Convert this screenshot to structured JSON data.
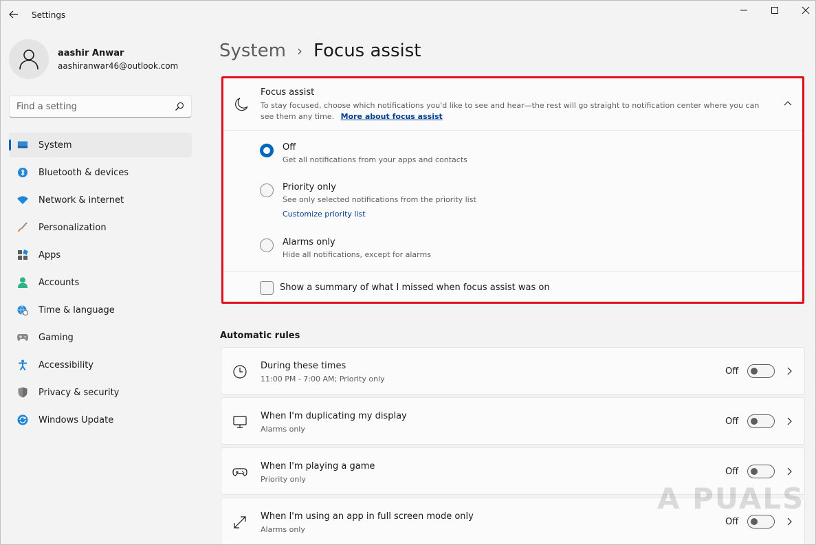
{
  "window": {
    "title": "Settings"
  },
  "profile": {
    "name": "aashir Anwar",
    "email": "aashiranwar46@outlook.com"
  },
  "search": {
    "placeholder": "Find a setting"
  },
  "nav": {
    "items": [
      {
        "label": "System",
        "icon": "system-icon",
        "active": true
      },
      {
        "label": "Bluetooth & devices",
        "icon": "bluetooth-icon"
      },
      {
        "label": "Network & internet",
        "icon": "wifi-icon"
      },
      {
        "label": "Personalization",
        "icon": "brush-icon"
      },
      {
        "label": "Apps",
        "icon": "apps-icon"
      },
      {
        "label": "Accounts",
        "icon": "accounts-icon"
      },
      {
        "label": "Time & language",
        "icon": "globe-clock-icon"
      },
      {
        "label": "Gaming",
        "icon": "gamepad-icon"
      },
      {
        "label": "Accessibility",
        "icon": "accessibility-icon"
      },
      {
        "label": "Privacy & security",
        "icon": "shield-icon"
      },
      {
        "label": "Windows Update",
        "icon": "update-icon"
      }
    ]
  },
  "breadcrumb": {
    "parent": "System",
    "separator": "›",
    "current": "Focus assist"
  },
  "focus_assist": {
    "title": "Focus assist",
    "description": "To stay focused, choose which notifications you'd like to see and hear—the rest will go straight to notification center where you can see them any time.",
    "link": "More about focus assist",
    "options": [
      {
        "label": "Off",
        "desc": "Get all notifications from your apps and contacts",
        "checked": true
      },
      {
        "label": "Priority only",
        "desc": "See only selected notifications from the priority list",
        "link": "Customize priority list"
      },
      {
        "label": "Alarms only",
        "desc": "Hide all notifications, except for alarms"
      }
    ],
    "summary_checkbox": "Show a summary of what I missed when focus assist was on"
  },
  "automatic_rules": {
    "title": "Automatic rules",
    "rules": [
      {
        "title": "During these times",
        "subtitle": "11:00 PM - 7:00 AM; Priority only",
        "state": "Off",
        "icon": "clock-icon"
      },
      {
        "title": "When I'm duplicating my display",
        "subtitle": "Alarms only",
        "state": "Off",
        "icon": "monitor-icon"
      },
      {
        "title": "When I'm playing a game",
        "subtitle": "Priority only",
        "state": "Off",
        "icon": "gamepad-icon"
      },
      {
        "title": "When I'm using an app in full screen mode only",
        "subtitle": "Alarms only",
        "state": "Off",
        "icon": "fullscreen-icon"
      }
    ]
  },
  "watermark": "A  PUALS",
  "colors": {
    "accent": "#0067c0",
    "highlight": "#e0101f",
    "link": "#003e92"
  }
}
